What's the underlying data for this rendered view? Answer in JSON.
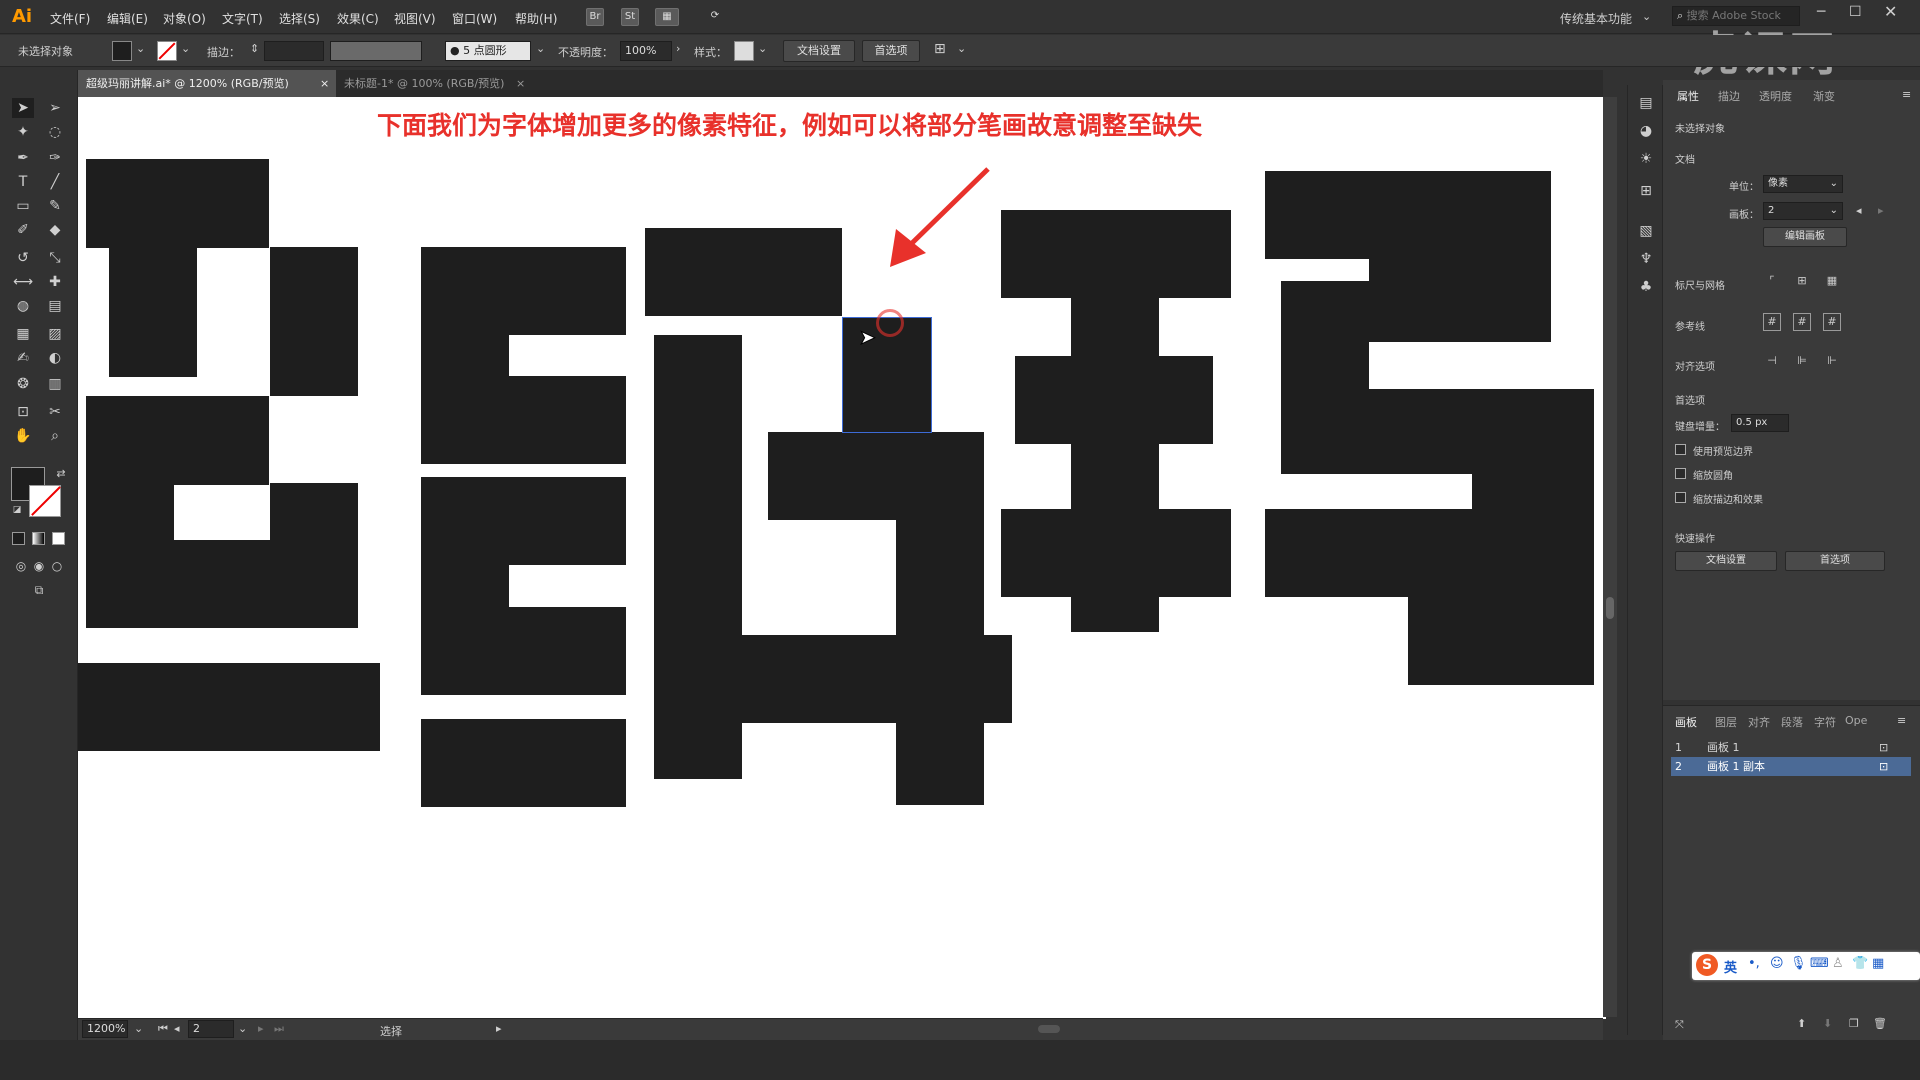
{
  "app": {
    "logo": "Ai",
    "menus": [
      "文件(F)",
      "编辑(E)",
      "对象(O)",
      "文字(T)",
      "选择(S)",
      "效果(C)",
      "视图(V)",
      "窗口(W)",
      "帮助(H)"
    ],
    "workspace": "传统基本功能",
    "search_placeholder": "搜索 Adobe Stock",
    "window_controls": [
      "minimize-icon",
      "maximize-icon",
      "close-icon"
    ],
    "watermark": "虎课网"
  },
  "options_bar": {
    "selection_label": "未选择对象",
    "stroke_label": "描边：",
    "brush_label": "5 点圆形",
    "opacity_label": "不透明度：",
    "opacity_value": "100%",
    "style_label": "样式：",
    "doc_setup_button": "文档设置",
    "prefs_button": "首选项"
  },
  "tabs": [
    {
      "label": "超级玛丽讲解.ai* @ 1200% (RGB/预览)",
      "active": true
    },
    {
      "label": "未标题-1* @ 100% (RGB/预览)",
      "active": false
    }
  ],
  "canvas": {
    "annotation": "下面我们为字体增加更多的像素特征，例如可以将部分笔画故意调整至缺失",
    "annotation_color": "#e8312b",
    "artwork_color": "#1e1e1e"
  },
  "status_bar": {
    "zoom": "1200%",
    "artboard_number": "2",
    "tool": "选择"
  },
  "properties_panel": {
    "tabs": [
      "属性",
      "描边",
      "透明度",
      "渐变"
    ],
    "selection": "未选择对象",
    "document_section": "文档",
    "unit_label": "单位：",
    "unit_value": "像素",
    "artboard_label": "画板：",
    "artboard_value": "2",
    "edit_artboard_button": "编辑画板",
    "rulers_section": "标尺与网格",
    "guides_section": "参考线",
    "align_section": "对齐选项",
    "prefs_section": "首选项",
    "keyboard_increment_label": "键盘增量：",
    "keyboard_increment_value": "0.5 px",
    "checkboxes": [
      "使用预览边界",
      "缩放圆角",
      "缩放描边和效果"
    ],
    "quick_actions_section": "快速操作",
    "quick_doc_setup": "文档设置",
    "quick_prefs": "首选项"
  },
  "artboards_panel": {
    "tabs": [
      "画板",
      "图层",
      "对齐",
      "段落",
      "字符",
      "Ope"
    ],
    "rows": [
      {
        "index": "1",
        "name": "画板 1",
        "selected": false
      },
      {
        "index": "2",
        "name": "画板 1 副本",
        "selected": true
      }
    ]
  },
  "ime_toolbar": {
    "mode": "英"
  }
}
